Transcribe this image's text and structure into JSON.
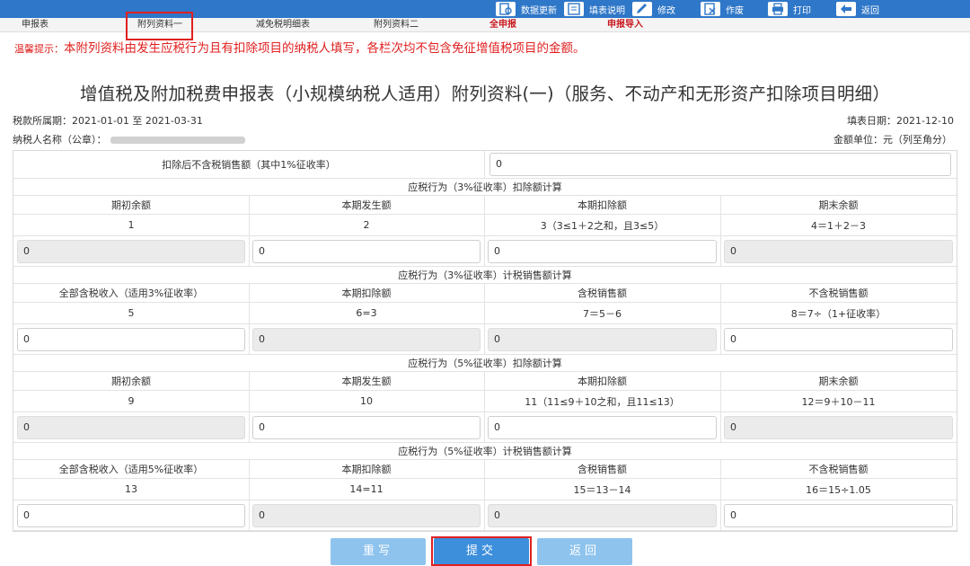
{
  "toolbar": {
    "data_update": "数据更新",
    "fill_guide": "填表说明",
    "edit": "修改",
    "void": "作废",
    "print": "打印",
    "back": "返回"
  },
  "tabs": {
    "declaration": "申报表",
    "attachment1": "附列资料一",
    "tax_reduction": "减免税明细表",
    "attachment2": "附列资料二",
    "full_declare": "全申报",
    "declare_import": "申报导入"
  },
  "tip": {
    "label": "温馨提示：",
    "text": "本附列资料由发生应税行为且有扣除项目的纳税人填写，各栏次均不包含免征增值税项目的金额。"
  },
  "title": "增值税及附加税费申报表（小规模纳税人适用）附列资料(一)（服务、不动产和无形资产扣除项目明细）",
  "meta": {
    "period": "税款所属期：2021-01-01 至 2021-03-31",
    "fill_date": "填表日期：2021-12-10",
    "taxpayer": "纳税人名称（公章）：",
    "unit": "金额单位：元（列至角分）"
  },
  "form": {
    "top_label": "扣除后不含税销售额（其中1%征收率）",
    "top_value": "0",
    "sections": [
      {
        "title": "应税行为（3%征收率）扣除额计算",
        "headers": [
          "期初余额",
          "本期发生额",
          "本期扣除额",
          "期末余额"
        ],
        "codes": [
          "1",
          "2",
          "3（3≤1＋2之和，且3≤5）",
          "4＝1＋2－3"
        ],
        "values": [
          "0",
          "0",
          "0",
          "0"
        ]
      },
      {
        "title": "应税行为（3%征收率）计税销售额计算",
        "headers": [
          "全部含税收入（适用3%征收率）",
          "本期扣除额",
          "含税销售额",
          "不含税销售额"
        ],
        "codes": [
          "5",
          "6=3",
          "7＝5－6",
          "8＝7÷（1+征收率）"
        ],
        "values": [
          "0",
          "0",
          "0",
          "0"
        ]
      },
      {
        "title": "应税行为（5%征收率）扣除额计算",
        "headers": [
          "期初余额",
          "本期发生额",
          "本期扣除额",
          "期末余额"
        ],
        "codes": [
          "9",
          "10",
          "11（11≤9＋10之和，且11≤13）",
          "12＝9＋10－11"
        ],
        "values": [
          "0",
          "0",
          "0",
          "0"
        ]
      },
      {
        "title": "应税行为（5%征收率）计税销售额计算",
        "headers": [
          "全部含税收入（适用5%征收率）",
          "本期扣除额",
          "含税销售额",
          "不含税销售额"
        ],
        "codes": [
          "13",
          "14=11",
          "15＝13－14",
          "16＝15÷1.05"
        ],
        "values": [
          "0",
          "0",
          "0",
          "0"
        ]
      }
    ]
  },
  "buttons": {
    "rewrite": "重写",
    "submit": "提交",
    "back": "返回"
  },
  "colors": {
    "toolbar_blue": "#2f77c8",
    "alert_red": "#e02020",
    "button_light": "#8ec3ee",
    "button_primary": "#3d8fdc"
  }
}
